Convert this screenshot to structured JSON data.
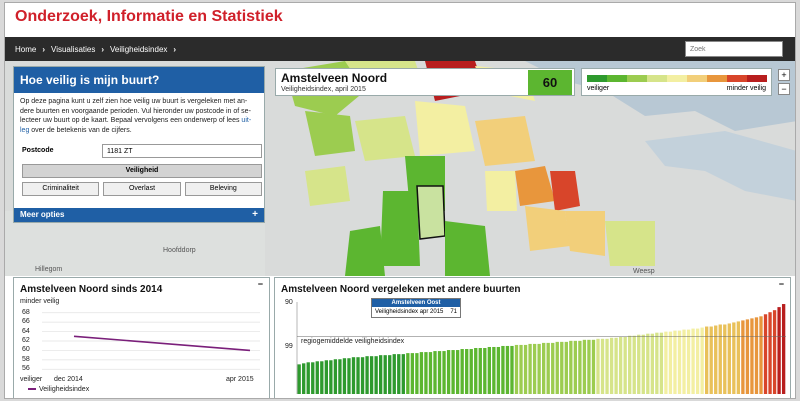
{
  "site": {
    "title": "Onderzoek, Informatie en Statistiek"
  },
  "nav": {
    "breadcrumbs": [
      "Home",
      "Visualisaties",
      "Veiligheidsindex"
    ],
    "search_placeholder": "Zoek"
  },
  "map": {
    "places": [
      "Hoofddorp",
      "Hillegom",
      "Weesp"
    ]
  },
  "info_panel": {
    "title": "Hoe veilig is mijn buurt?",
    "text_before": "Op deze pagina kunt u zelf zien hoe veilig uw buurt is vergeleken met an-dere buurten en voorgaande perioden. Vul hieronder uw postcode in of se-lecteer uw buurt op de kaart. Bepaal vervolgens een onderwerp of lees ",
    "text_link": "uit-leg",
    "text_after": " over de betekenis van de cijfers.",
    "postcode_label": "Postcode",
    "postcode_value": "1181 ZT",
    "main_button": "Veiligheid",
    "sub_buttons": [
      "Criminaliteit",
      "Overlast",
      "Beleving"
    ],
    "more_options": "Meer opties",
    "more_icon": "plus-icon"
  },
  "area_panel": {
    "name": "Amstelveen Noord",
    "subtitle": "Veiligheidsindex, april 2015",
    "score": "60",
    "score_color": "#5cb630"
  },
  "legend": {
    "left_label": "veiliger",
    "right_label": "minder veilig",
    "colors": [
      "#2e9a2e",
      "#5cb630",
      "#9ccc50",
      "#d6e48a",
      "#f3efa2",
      "#f2cf7a",
      "#e8963c",
      "#d8452a",
      "#b81e1e"
    ]
  },
  "zoom": {
    "in": "+",
    "out": "−"
  },
  "trend_panel": {
    "title": "Amstelveen Noord sinds 2014",
    "top_label": "minder veilig",
    "bottom_label": "veiliger",
    "minimize": "−",
    "legend_label": "Veiligheidsindex"
  },
  "compare_panel": {
    "title": "Amstelveen Noord vergeleken met andere buurten",
    "minimize": "−",
    "reference_label": "regiogemiddelde veiligheidsindex",
    "tooltip_title": "Amstelveen Oost",
    "tooltip_label": "Veiligheidsindex apr 2015",
    "tooltip_value": "71"
  },
  "chart_data": [
    {
      "type": "line",
      "x": [
        "dec 2014",
        "apr 2015"
      ],
      "series": [
        {
          "name": "Veiligheidsindex",
          "values": [
            63,
            60
          ],
          "color": "#7a1f7a"
        }
      ],
      "yticks": [
        68,
        66,
        64,
        62,
        60,
        58,
        56
      ],
      "ylim": [
        55,
        69
      ],
      "grid": true
    },
    {
      "type": "bar",
      "yticks": [
        "90",
        "99"
      ],
      "ylim": [
        0,
        90
      ],
      "reference_value": 56,
      "values": [
        29,
        30,
        31,
        31,
        32,
        32,
        33,
        33,
        34,
        34,
        35,
        35,
        36,
        36,
        36,
        37,
        37,
        37,
        38,
        38,
        38,
        39,
        39,
        39,
        40,
        40,
        40,
        41,
        41,
        41,
        42,
        42,
        42,
        43,
        43,
        43,
        44,
        44,
        44,
        45,
        45,
        45,
        46,
        46,
        46,
        47,
        47,
        47,
        48,
        48,
        48,
        49,
        49,
        49,
        50,
        50,
        50,
        51,
        51,
        51,
        52,
        52,
        52,
        53,
        53,
        53,
        54,
        54,
        54,
        55,
        55,
        56,
        56,
        57,
        57,
        58,
        58,
        59,
        59,
        60,
        60,
        61,
        61,
        62,
        62,
        63,
        63,
        64,
        64,
        65,
        66,
        66,
        67,
        68,
        68,
        69,
        70,
        71,
        72,
        73,
        74,
        75,
        76,
        78,
        80,
        82,
        85,
        88
      ]
    }
  ]
}
